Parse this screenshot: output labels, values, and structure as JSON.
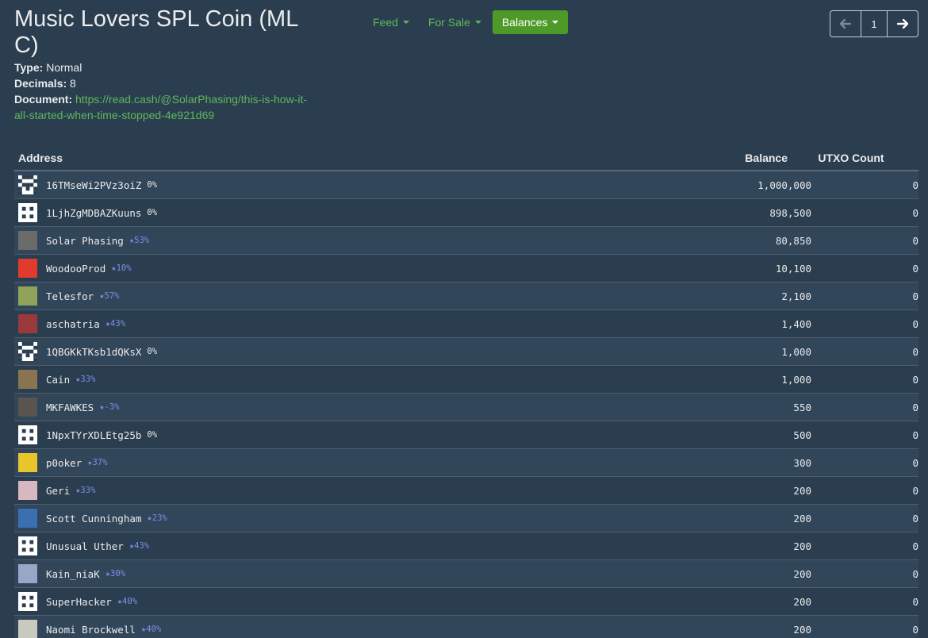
{
  "token": {
    "title": "Music Lovers SPL Coin (MLC)",
    "type_label": "Type:",
    "type_value": "Normal",
    "decimals_label": "Decimals:",
    "decimals_value": "8",
    "document_label": "Document:",
    "document_url": "https://read.cash/@SolarPhasing/this-is-how-it-all-started-when-time-stopped-4e921d69"
  },
  "nav": {
    "feed": "Feed",
    "for_sale": "For Sale",
    "balances": "Balances"
  },
  "pager": {
    "page": "1",
    "prev_icon": "arrow-left-icon",
    "next_icon": "arrow-right-icon"
  },
  "table": {
    "headers": {
      "address": "Address",
      "balance": "Balance",
      "utxo": "UTXO Count"
    },
    "rows": [
      {
        "name": "16TMseWi2PVz3oiZ",
        "tag": "0%",
        "rated": false,
        "balance": "1,000,000",
        "utxo": "0",
        "avatar": "identicon",
        "color": "#ffffff"
      },
      {
        "name": "1LjhZgMDBAZKuuns",
        "tag": "0%",
        "rated": false,
        "balance": "898,500",
        "utxo": "0",
        "avatar": "identicon",
        "color": "#ffffff"
      },
      {
        "name": "Solar Phasing",
        "tag": "★53%",
        "rated": true,
        "balance": "80,850",
        "utxo": "0",
        "avatar": "photo",
        "color": "#6b6b6b"
      },
      {
        "name": "WoodooProd",
        "tag": "★10%",
        "rated": true,
        "balance": "10,100",
        "utxo": "0",
        "avatar": "photo",
        "color": "#e23b2e"
      },
      {
        "name": "Telesfor",
        "tag": "★57%",
        "rated": true,
        "balance": "2,100",
        "utxo": "0",
        "avatar": "photo",
        "color": "#8fa35a"
      },
      {
        "name": "aschatria",
        "tag": "★43%",
        "rated": true,
        "balance": "1,400",
        "utxo": "0",
        "avatar": "photo",
        "color": "#9b3a3a"
      },
      {
        "name": "1QBGKkTKsb1dQKsX",
        "tag": "0%",
        "rated": false,
        "balance": "1,000",
        "utxo": "0",
        "avatar": "identicon",
        "color": "#ffffff"
      },
      {
        "name": "Cain",
        "tag": "★33%",
        "rated": true,
        "balance": "1,000",
        "utxo": "0",
        "avatar": "photo",
        "color": "#8a7350"
      },
      {
        "name": "MKFAWKES",
        "tag": "★-3%",
        "rated": true,
        "balance": "550",
        "utxo": "0",
        "avatar": "photo",
        "color": "#5a5550"
      },
      {
        "name": "1NpxTYrXDLEtg25b",
        "tag": "0%",
        "rated": false,
        "balance": "500",
        "utxo": "0",
        "avatar": "identicon",
        "color": "#ffffff"
      },
      {
        "name": "p0oker",
        "tag": "★37%",
        "rated": true,
        "balance": "300",
        "utxo": "0",
        "avatar": "photo",
        "color": "#e8c52a"
      },
      {
        "name": "Geri",
        "tag": "★33%",
        "rated": true,
        "balance": "200",
        "utxo": "0",
        "avatar": "photo",
        "color": "#d8b8c0"
      },
      {
        "name": "Scott Cunningham",
        "tag": "★23%",
        "rated": true,
        "balance": "200",
        "utxo": "0",
        "avatar": "photo",
        "color": "#3a6fb0"
      },
      {
        "name": "Unusual Uther",
        "tag": "★43%",
        "rated": true,
        "balance": "200",
        "utxo": "0",
        "avatar": "identicon",
        "color": "#ffffff"
      },
      {
        "name": "Kain_niaK",
        "tag": "★30%",
        "rated": true,
        "balance": "200",
        "utxo": "0",
        "avatar": "photo",
        "color": "#9aa6c8"
      },
      {
        "name": "SuperHacker",
        "tag": "★40%",
        "rated": true,
        "balance": "200",
        "utxo": "0",
        "avatar": "identicon",
        "color": "#ffffff"
      },
      {
        "name": "Naomi Brockwell",
        "tag": "★40%",
        "rated": true,
        "balance": "200",
        "utxo": "0",
        "avatar": "photo",
        "color": "#c9c9c0"
      }
    ]
  }
}
